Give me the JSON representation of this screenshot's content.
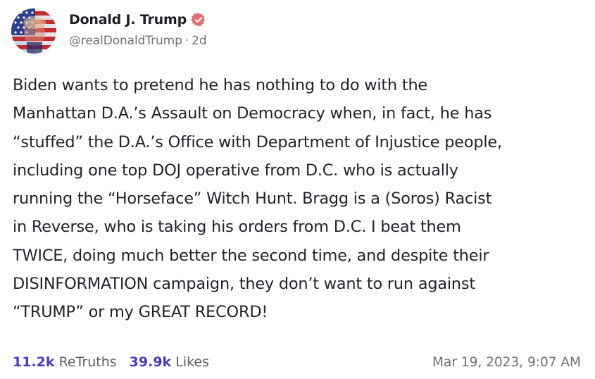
{
  "post": {
    "author": {
      "display_name": "Donald J. Trump",
      "verified_icon": "verified-badge-icon",
      "handle": "@realDonaldTrump",
      "separator": "·",
      "relative_time": "2d"
    },
    "body": "Biden wants to pretend he has nothing to do with the\nManhattan D.A.’s Assault on Democracy when, in fact, he has\n“stuffed” the D.A.’s Office with Department of Injustice people,\nincluding one top DOJ operative from D.C. who is actually\nrunning the “Horseface” Witch Hunt. Bragg is a (Soros) Racist\nin Reverse, who is taking his orders from D.C. I beat them\nTWICE, doing much better the second time, and despite their\nDISINFORMATION campaign, they don’t want to run against\n“TRUMP” or my GREAT RECORD!",
    "stats": {
      "retruths_count": "11.2k",
      "retruths_label": "ReTruths",
      "likes_count": "39.9k",
      "likes_label": "Likes"
    },
    "timestamp": "Mar 19, 2023, 9:07 AM"
  },
  "colors": {
    "accent": "#4a3bc4",
    "verified_badge": "#e36f6f",
    "text": "#22222c",
    "muted": "#6f6f7b"
  }
}
